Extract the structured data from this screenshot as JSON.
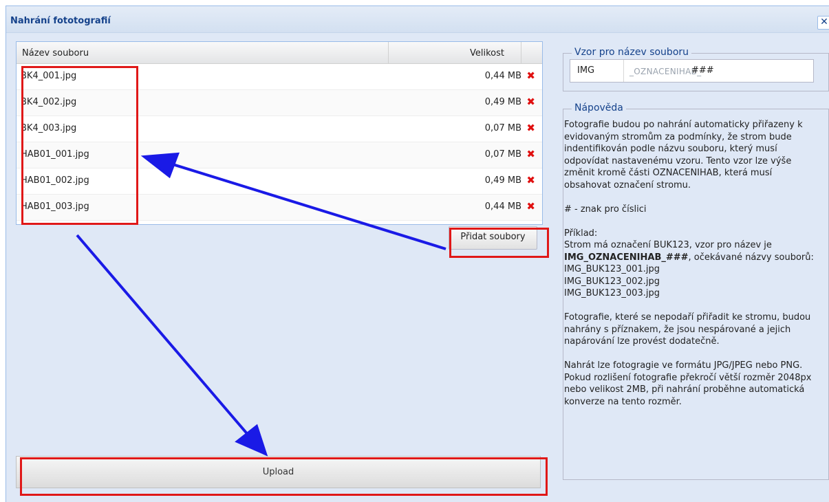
{
  "dialog": {
    "title": "Nahrání fototografií",
    "close_label": "✕"
  },
  "grid": {
    "columns": {
      "name": "Název souboru",
      "size": "Velikost"
    },
    "delete_glyph": "✖",
    "rows": [
      {
        "name": "BK4_001.jpg",
        "size": "0,44 MB"
      },
      {
        "name": "BK4_002.jpg",
        "size": "0,49 MB"
      },
      {
        "name": "BK4_003.jpg",
        "size": "0,07 MB"
      },
      {
        "name": "HAB01_001.jpg",
        "size": "0,07 MB"
      },
      {
        "name": "HAB01_002.jpg",
        "size": "0,49 MB"
      },
      {
        "name": "HAB01_003.jpg",
        "size": "0,44 MB"
      }
    ]
  },
  "buttons": {
    "add_files": "Přidat soubory",
    "upload": "Upload"
  },
  "pattern": {
    "legend": "Vzor pro název souboru",
    "prefix": "IMG",
    "middle": "_OZNACENIHAB_",
    "suffix": "###"
  },
  "help": {
    "legend": "Nápověda",
    "p1": "Fotografie budou po nahrání automaticky přiřazeny k evidovaným stromům za podmínky, že strom bude indentifikován podle názvu souboru, který musí odpovídat nastavenému vzoru. Tento vzor lze výše změnit kromě části OZNACENIHAB, která musí obsahovat označení stromu.",
    "p2": "# - znak pro číslici",
    "example_label": "Příklad:",
    "example_line": "Strom má označení BUK123, vzor pro název je",
    "example_pattern": "IMG_OZNACENIHAB_###",
    "example_tail": ", očekávané názvy souborů:",
    "example_files": [
      "IMG_BUK123_001.jpg",
      "IMG_BUK123_002.jpg",
      "IMG_BUK123_003.jpg"
    ],
    "p3": "Fotografie, které se nepodaří přiřadit ke stromu, budou nahrány s příznakem, že jsou nespárované a jejich napárování lze provést dodatečně.",
    "p4": "Nahrát lze fotogragie ve formátu JPG/JPEG nebo PNG. Pokud rozlišení fotografie překročí větší rozměr 2048px nebo velikost 2MB, při nahrání proběhne automatická konverze na tento rozměr."
  },
  "colors": {
    "highlight": "#e01818",
    "arrow": "#1a1ae6",
    "title": "#15428b"
  }
}
